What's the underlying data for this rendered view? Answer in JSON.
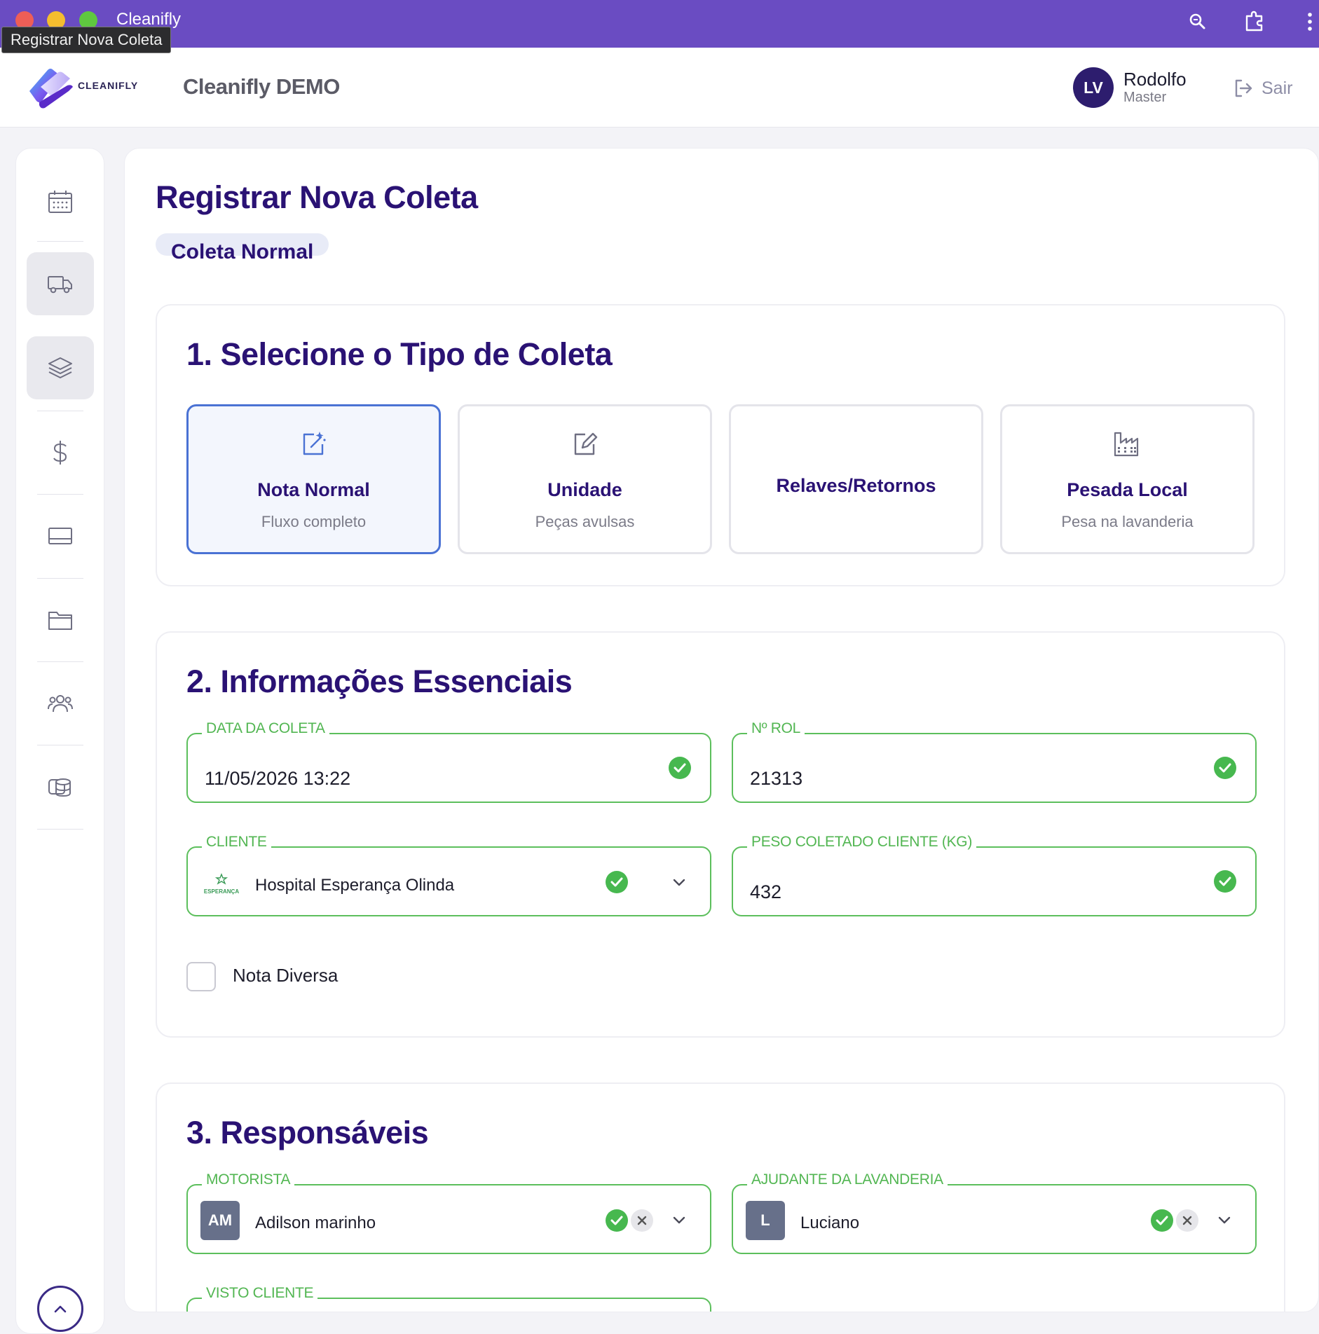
{
  "window": {
    "title": "Cleanifly",
    "tooltip": "Registrar Nova Coleta"
  },
  "header": {
    "logo_text": "CLEANIFLY",
    "app_name": "Cleanifly DEMO",
    "user": {
      "initials": "LV",
      "name": "Rodolfo",
      "role": "Master"
    },
    "logout_label": "Sair"
  },
  "sidebar": {
    "items": [
      {
        "icon": "calendar-icon",
        "active": false
      },
      {
        "icon": "truck-icon",
        "active": true
      },
      {
        "icon": "layers-icon",
        "active": true
      },
      {
        "icon": "dollar-icon",
        "active": false
      },
      {
        "icon": "tray-icon",
        "active": false
      },
      {
        "icon": "folder-icon",
        "active": false
      },
      {
        "icon": "users-icon",
        "active": false
      },
      {
        "icon": "database-icon",
        "active": false
      }
    ]
  },
  "page": {
    "title": "Registrar Nova Coleta",
    "chip": "Coleta Normal"
  },
  "section1": {
    "title": "1. Selecione o Tipo de Coleta",
    "options": [
      {
        "title": "Nota Normal",
        "subtitle": "Fluxo completo",
        "icon": "edit-sparkle-icon",
        "selected": true
      },
      {
        "title": "Unidade",
        "subtitle": "Peças avulsas",
        "icon": "edit-icon",
        "selected": false
      },
      {
        "title": "Relaves/Retornos",
        "subtitle": "",
        "icon": "",
        "selected": false
      },
      {
        "title": "Pesada Local",
        "subtitle": "Pesa na lavanderia",
        "icon": "factory-icon",
        "selected": false
      }
    ]
  },
  "section2": {
    "title": "2. Informações Essenciais",
    "data_coleta": {
      "label": "DATA DA COLETA",
      "value": "11/05/2026 13:22"
    },
    "n_rol": {
      "label": "Nº ROL",
      "value": "21313"
    },
    "cliente": {
      "label": "CLIENTE",
      "value": "Hospital Esperança Olinda",
      "logo_text": "ESPERANÇA"
    },
    "peso": {
      "label": "PESO COLETADO CLIENTE (KG)",
      "value": "432"
    },
    "nota_diversa": {
      "label": "Nota Diversa",
      "checked": false
    }
  },
  "section3": {
    "title": "3. Responsáveis",
    "motorista": {
      "label": "MOTORISTA",
      "initials": "AM",
      "value": "Adilson marinho"
    },
    "ajudante": {
      "label": "AJUDANTE DA LAVANDERIA",
      "initials": "L",
      "value": "Luciano"
    },
    "visto_cliente": {
      "label": "VISTO CLIENTE"
    }
  },
  "colors": {
    "titlebar": "#6a4cc2",
    "brand_dark": "#2a1274",
    "success_green": "#47b84f",
    "field_border": "#5cbf5c",
    "selected_border": "#4a72d4"
  }
}
